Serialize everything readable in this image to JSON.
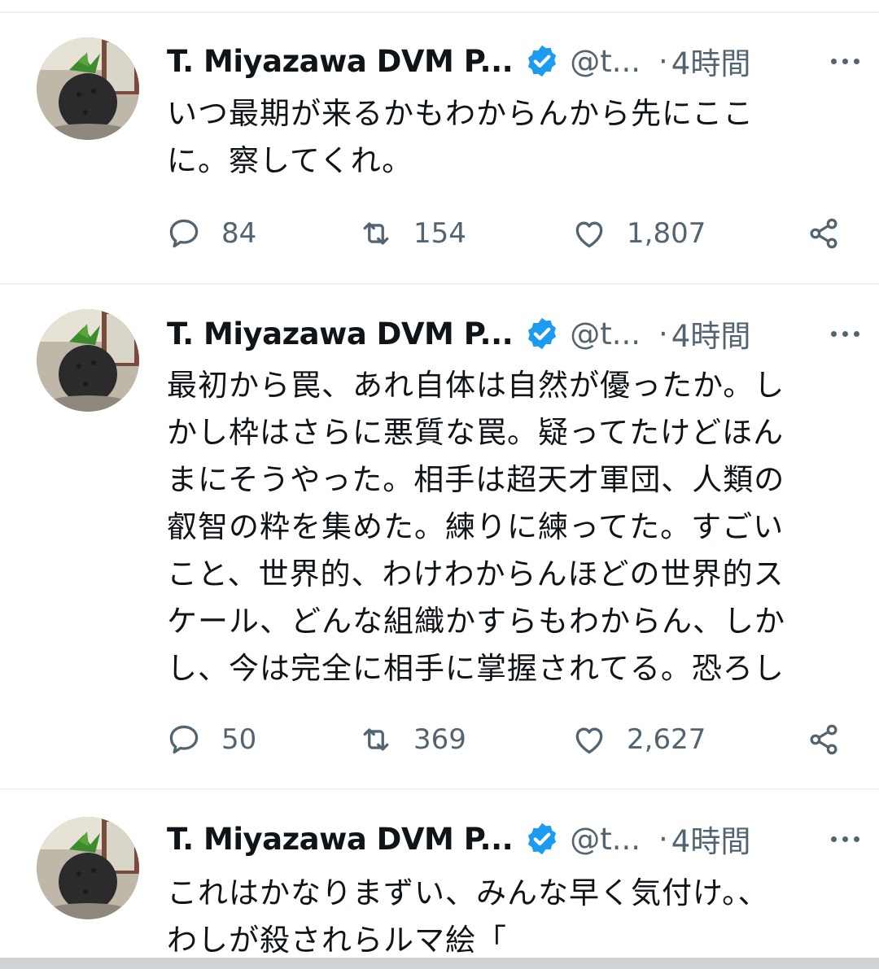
{
  "colors": {
    "text": "#0f1419",
    "secondary": "#536471",
    "verified": "#1d9bf0",
    "divider": "#eff3f4"
  },
  "tweets": [
    {
      "name": "T. Miyazawa DVM P...",
      "handle": "@t...",
      "dot": "·",
      "time": "4時間",
      "text": "いつ最期が来るかもわからんから先にここ\nに。察してくれ。",
      "replies": "84",
      "retweets": "154",
      "likes": "1,807"
    },
    {
      "name": "T. Miyazawa DVM P...",
      "handle": "@t...",
      "dot": "·",
      "time": "4時間",
      "text": "最初から罠、あれ自体は自然が優ったか。し\nかし枠はさらに悪質な罠。疑ってたけどほん\nまにそうやった。相手は超天才軍団、人類の\n叡智の粋を集めた。練りに練ってた。すごい\nこと、世界的、わけわからんほどの世界的ス\nケール、どんな組織かすらもわからん、しか\nし、今は完全に相手に掌握されてる。恐ろし",
      "replies": "50",
      "retweets": "369",
      "likes": "2,627"
    },
    {
      "name": "T. Miyazawa DVM P...",
      "handle": "@t...",
      "dot": "·",
      "time": "4時間",
      "text": "これはかなりまずい、みんな早く気付け。、\nわしが殺されらルマ絵「"
    }
  ],
  "icons": {
    "avatar": "avatar-image",
    "verified": "verified-badge-icon",
    "more": "more-options-icon",
    "reply": "reply-icon",
    "retweet": "retweet-icon",
    "like": "heart-icon",
    "share": "share-icon"
  }
}
